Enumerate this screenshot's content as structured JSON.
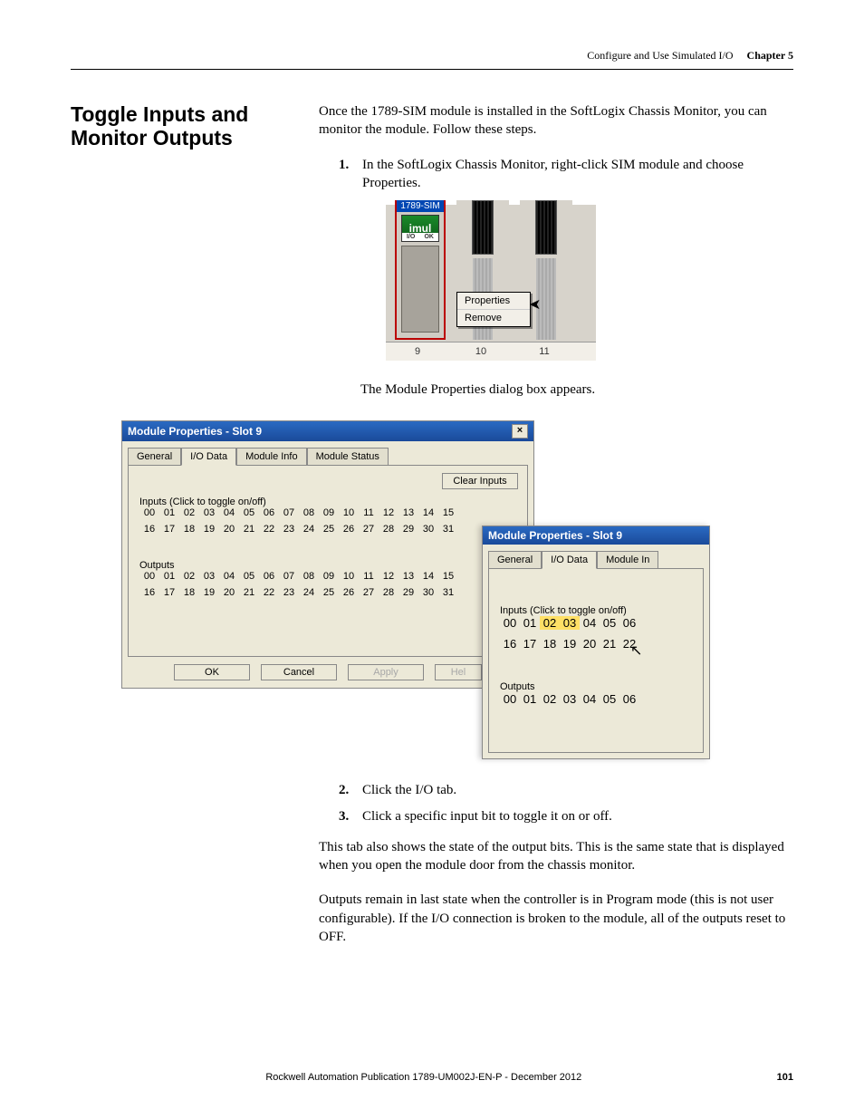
{
  "header": {
    "breadcrumb": "Configure and Use Simulated I/O",
    "chapter": "Chapter 5"
  },
  "section_title": "Toggle Inputs and Monitor Outputs",
  "intro_para": "Once the 1789-SIM module is installed in the SoftLogix Chassis Monitor, you can monitor the module. Follow these steps.",
  "step1_num": "1.",
  "step1_text": "In the SoftLogix Chassis Monitor, right-click SIM module and choose Properties.",
  "fig1": {
    "module_label": "1789-SIM",
    "green_text": "imul",
    "strip_left": "I/O",
    "strip_right": "OK",
    "slot_a": "9",
    "slot_b": "10",
    "slot_c": "11",
    "menu_properties": "Properties",
    "menu_remove": "Remove"
  },
  "after_fig1": "The Module Properties dialog box appears.",
  "dlg1": {
    "title": "Module Properties - Slot 9",
    "tabs": {
      "general": "General",
      "io": "I/O Data",
      "info": "Module Info",
      "status": "Module Status"
    },
    "clear_inputs": "Clear Inputs",
    "inputs_label": "Inputs   (Click to toggle on/off)",
    "row1": [
      "00",
      "01",
      "02",
      "03",
      "04",
      "05",
      "06",
      "07",
      "08",
      "09",
      "10",
      "11",
      "12",
      "13",
      "14",
      "15"
    ],
    "row2": [
      "16",
      "17",
      "18",
      "19",
      "20",
      "21",
      "22",
      "23",
      "24",
      "25",
      "26",
      "27",
      "28",
      "29",
      "30",
      "31"
    ],
    "outputs_label": "Outputs",
    "orow1": [
      "00",
      "01",
      "02",
      "03",
      "04",
      "05",
      "06",
      "07",
      "08",
      "09",
      "10",
      "11",
      "12",
      "13",
      "14",
      "15"
    ],
    "orow2": [
      "16",
      "17",
      "18",
      "19",
      "20",
      "21",
      "22",
      "23",
      "24",
      "25",
      "26",
      "27",
      "28",
      "29",
      "30",
      "31"
    ],
    "ok": "OK",
    "cancel": "Cancel",
    "apply": "Apply",
    "help": "Hel"
  },
  "dlg2": {
    "title": "Module Properties - Slot 9",
    "tabs": {
      "general": "General",
      "io": "I/O Data",
      "info": "Module In"
    },
    "inputs_label": "Inputs   (Click to toggle on/off)",
    "row1": [
      "00",
      "01",
      "02",
      "03",
      "04",
      "05",
      "06"
    ],
    "row1_hl": [
      2,
      3
    ],
    "row2": [
      "16",
      "17",
      "18",
      "19",
      "20",
      "21",
      "22"
    ],
    "outputs_label": "Outputs",
    "orow1": [
      "00",
      "01",
      "02",
      "03",
      "04",
      "05",
      "06"
    ]
  },
  "step2_num": "2.",
  "step2_text": "Click the I/O tab.",
  "step3_num": "3.",
  "step3_text": "Click a specific input bit to toggle it on or off.",
  "para_a": "This tab also shows the state of the output bits. This is the same state that is displayed when you open the module door from the chassis monitor.",
  "para_b": "Outputs remain in last state when the controller is in Program mode (this is not user configurable). If the I/O connection is broken to the module, all of the outputs reset to OFF.",
  "footer": {
    "pub": "Rockwell Automation Publication 1789-UM002J-EN-P - December 2012",
    "page": "101"
  }
}
